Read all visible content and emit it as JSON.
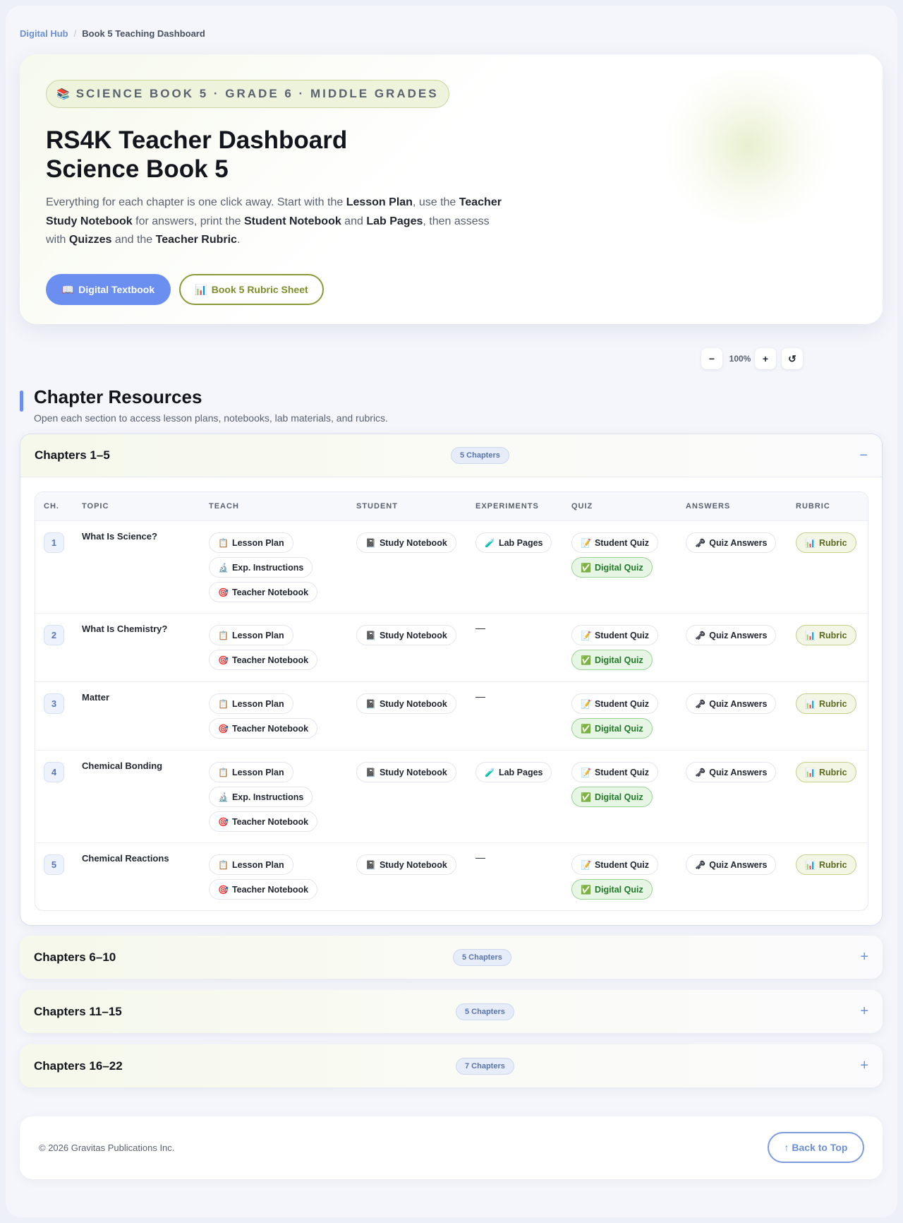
{
  "breadcrumb": {
    "root": "Digital Hub",
    "separator": "/",
    "current": "Book 5 Teaching Dashboard"
  },
  "hero": {
    "eyebrow_icon": "📚",
    "eyebrow": "SCIENCE BOOK 5 · GRADE 6 · MIDDLE GRADES",
    "title_line1": "RS4K Teacher Dashboard",
    "title_line2": "Science Book 5",
    "intro": {
      "t1": "Everything for each chapter is one click away. Start with the ",
      "b1": "Lesson Plan",
      "t2": ", use the ",
      "b2": "Teacher Study Notebook",
      "t3": " for answers, print the ",
      "b3": "Student Notebook",
      "t4": " and ",
      "b4": "Lab Pages",
      "t5": ", then assess with ",
      "b5": "Quizzes",
      "t6": " and the ",
      "b6": "Teacher Rubric",
      "t7": "."
    },
    "primary_button": {
      "icon": "📖",
      "label": "Digital Textbook"
    },
    "secondary_button": {
      "icon": "📊",
      "label": "Book 5 Rubric Sheet"
    }
  },
  "zoom": {
    "minus": "−",
    "level": "100%",
    "plus": "+",
    "reset": "↺"
  },
  "section": {
    "title": "Chapter Resources",
    "subtitle": "Open each section to access lesson plans, notebooks, lab materials, and rubrics."
  },
  "columns": {
    "ch": "CH.",
    "topic": "TOPIC",
    "teach": "TEACH",
    "student": "STUDENT",
    "experiments": "EXPERIMENTS",
    "quiz": "QUIZ",
    "answers": "ANSWERS",
    "rubric": "RUBRIC"
  },
  "accordions": [
    {
      "title": "Chapters 1–5",
      "badge": "5 Chapters",
      "toggle": "−"
    },
    {
      "title": "Chapters 6–10",
      "badge": "5 Chapters",
      "toggle": "+"
    },
    {
      "title": "Chapters 11–15",
      "badge": "5 Chapters",
      "toggle": "+"
    },
    {
      "title": "Chapters 16–22",
      "badge": "7 Chapters",
      "toggle": "+"
    }
  ],
  "icons": {
    "lesson_plan": "📋",
    "exp_instructions": "🔬",
    "teacher_notebook": "🎯",
    "study_notebook": "📓",
    "lab_pages": "🧪",
    "student_quiz": "📝",
    "digital_quiz": "✅",
    "quiz_answers": "🗝",
    "rubric": "📊"
  },
  "labels": {
    "lesson_plan": "Lesson Plan",
    "exp_instructions": "Exp. Instructions",
    "teacher_notebook": "Teacher Notebook",
    "study_notebook": "Study Notebook",
    "lab_pages": "Lab Pages",
    "student_quiz": "Student Quiz",
    "digital_quiz": "Digital Quiz",
    "quiz_answers": "Quiz Answers",
    "rubric": "Rubric",
    "none": "—"
  },
  "chapters": [
    {
      "num": "1",
      "topic": "What Is Science?"
    },
    {
      "num": "2",
      "topic": "What Is Chemistry?"
    },
    {
      "num": "3",
      "topic": "Matter"
    },
    {
      "num": "4",
      "topic": "Chemical Bonding"
    },
    {
      "num": "5",
      "topic": "Chemical Reactions"
    }
  ],
  "footer": {
    "copyright": "© 2026 Gravitas Publications Inc.",
    "back_to_top": "↑ Back to Top"
  },
  "colors": {
    "accent": "#6b8ff0",
    "olive": "#8a9a3a",
    "green": "#237a2a"
  }
}
